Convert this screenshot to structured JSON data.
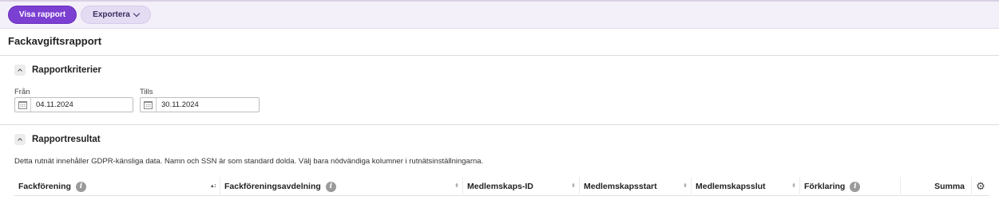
{
  "toolbar": {
    "show_report_label": "Visa rapport",
    "export_label": "Exportera"
  },
  "page": {
    "title": "Fackavgiftsrapport"
  },
  "criteria": {
    "title": "Rapportkriterier",
    "from_label": "Från",
    "from_value": "04.11.2024",
    "to_label": "Tills",
    "to_value": "30.11.2024"
  },
  "results": {
    "title": "Rapportresultat",
    "gdpr_notice": "Detta rutnät innehåller GDPR-känsliga data. Namn och SSN är som standard dolda. Välj bara nödvändiga kolumner i rutnätsinställningarna.",
    "columns": [
      {
        "label": "Fackförening",
        "info": true,
        "sort": "asc"
      },
      {
        "label": "Fackföreningsavdelning",
        "info": true,
        "sort": "none"
      },
      {
        "label": "Medlemskaps-ID",
        "info": false,
        "sort": "none"
      },
      {
        "label": "Medlemskapsstart",
        "info": false,
        "sort": "none"
      },
      {
        "label": "Medlemskapsslut",
        "info": false,
        "sort": "none"
      },
      {
        "label": "Förklaring",
        "info": true,
        "sort": "none"
      },
      {
        "label": "Summa",
        "info": false,
        "sort": "none"
      }
    ]
  },
  "icons": {
    "info": "info-icon",
    "calendar": "calendar-icon",
    "settings": "gear-icon",
    "collapse": "chevron-up-icon",
    "dropdown": "chevron-down-icon"
  },
  "colors": {
    "primary": "#7b3fd1",
    "secondary": "#e4dcf3",
    "toolbar_bg": "#f4f0fa"
  }
}
